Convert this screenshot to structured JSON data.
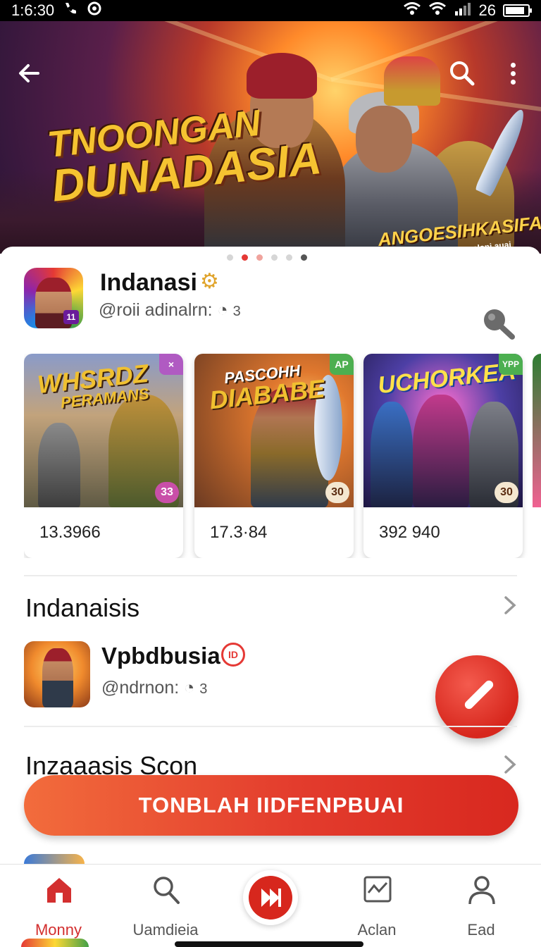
{
  "status_bar": {
    "time": "1:6:30",
    "battery_level": 0.85
  },
  "hero": {
    "title_line1": "TNOONGAN",
    "title_line2": "DUNADASIA",
    "subtitle": "ANGOESIHKASIFAN",
    "subtext": "Vepasoia Mamomolani auai",
    "carousel_dots": 6,
    "active_dot": 1
  },
  "app": {
    "name": "Indanasi",
    "handle": "@roii adinalrn:",
    "handle_count": "3",
    "icon_badge": "11"
  },
  "cards": [
    {
      "title_line1": "WHSRDZ",
      "title_line2": "PERAMANS",
      "tag": "×",
      "tag_color": "#b05ac2",
      "count": "33",
      "value": "13.3966"
    },
    {
      "title_line1": "PASCOHH",
      "title_line2": "DIABABE",
      "tag": "AP",
      "tag_color": "#4caf50",
      "count": "30",
      "value": "17.3·84"
    },
    {
      "title_line1": "UCHORKEA",
      "title_line2": "",
      "tag": "YPP",
      "tag_color": "#4caf50",
      "count": "30",
      "value": "392 940"
    }
  ],
  "section1": {
    "title": "Indanaisis"
  },
  "list_item": {
    "name": "Vpbdbusia",
    "badge": "ID",
    "handle": "@ndrnon:",
    "handle_count": "3"
  },
  "section2": {
    "title": "Inzaaasis Scon"
  },
  "cta": {
    "label": "TONBLAH IIDFENPBUAI"
  },
  "nav": [
    {
      "label": "Monny",
      "icon": "home-icon",
      "active": true
    },
    {
      "label": "Uamdieia",
      "icon": "search-icon",
      "active": false
    },
    {
      "label": "",
      "icon": "play-forward-icon",
      "active": false
    },
    {
      "label": "Aclan",
      "icon": "chart-icon",
      "active": false
    },
    {
      "label": "Ead",
      "icon": "profile-icon",
      "active": false
    }
  ],
  "colors": {
    "accent": "#d7271d",
    "active_nav": "#d32f2f"
  }
}
